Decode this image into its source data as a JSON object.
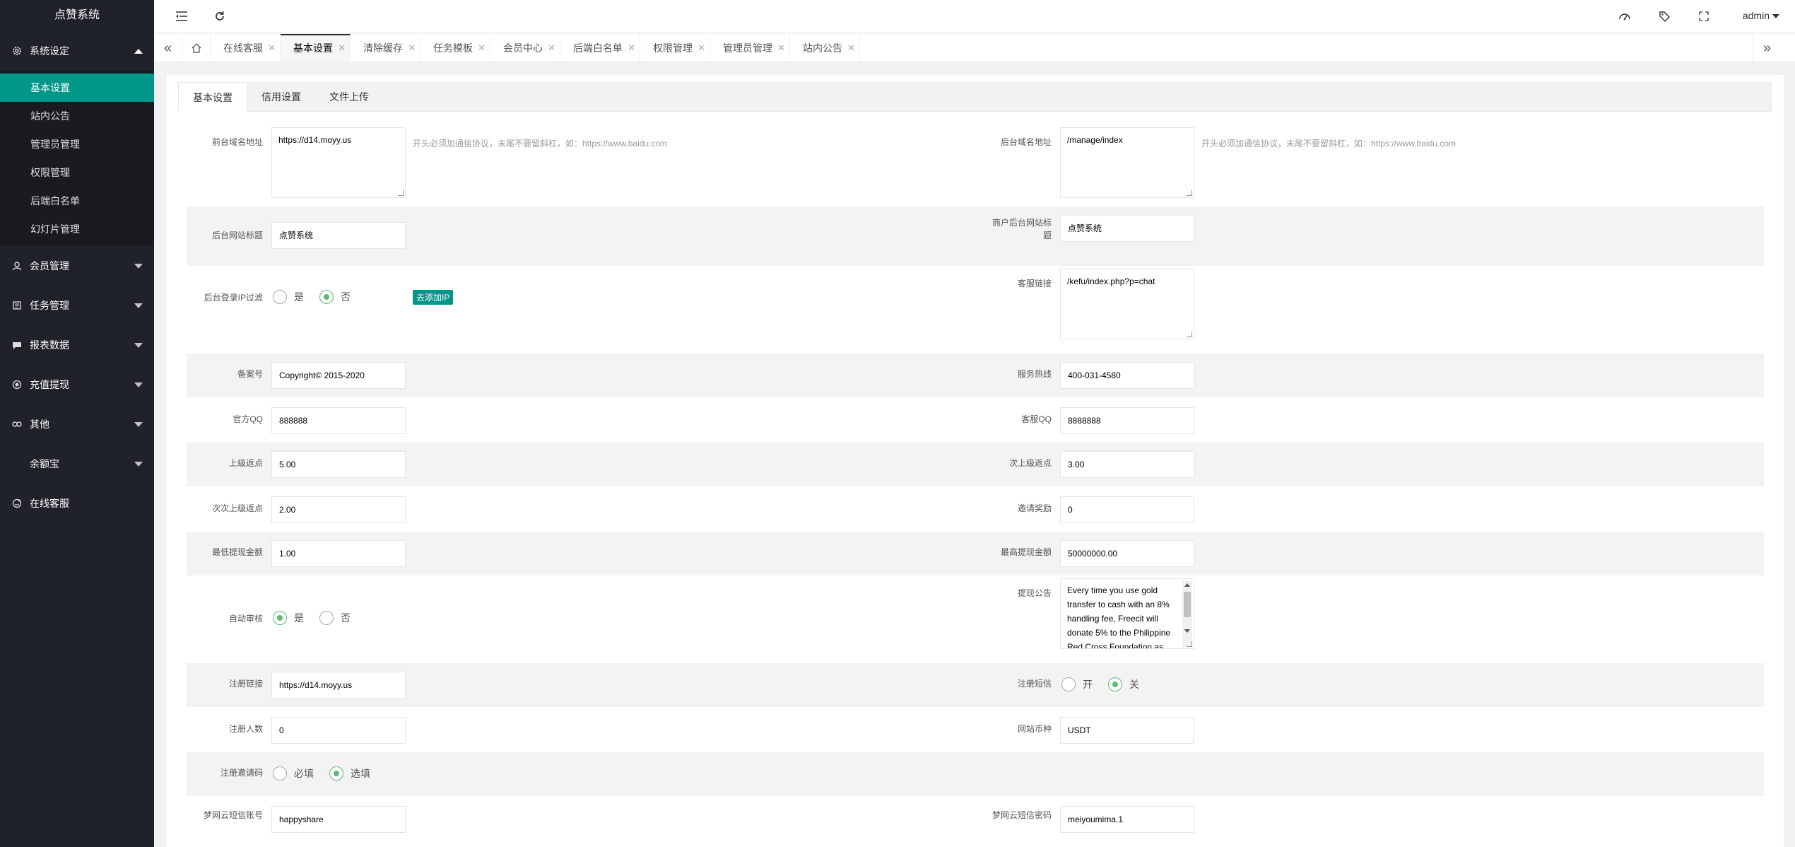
{
  "app": {
    "title": "点赞系统",
    "user": "admin"
  },
  "sidebar": {
    "groups": [
      {
        "label": "系统设定",
        "icon": "gear-icon",
        "expanded": true,
        "items": [
          "基本设置",
          "站内公告",
          "管理员管理",
          "权限管理",
          "后端白名单",
          "幻灯片管理"
        ],
        "active": "基本设置"
      },
      {
        "label": "会员管理",
        "icon": "user-icon"
      },
      {
        "label": "任务管理",
        "icon": "list-icon"
      },
      {
        "label": "报表数据",
        "icon": "chat-icon"
      },
      {
        "label": "充值提现",
        "icon": "coin-icon"
      },
      {
        "label": "其他",
        "icon": "link-icon"
      },
      {
        "label": "余额宝",
        "icon": ""
      },
      {
        "label": "在线客服",
        "icon": "service-icon"
      }
    ]
  },
  "tabs": [
    "在线客服",
    "基本设置",
    "清除缓存",
    "任务模板",
    "会员中心",
    "后端白名单",
    "权限管理",
    "管理员管理",
    "站内公告"
  ],
  "active_tab": "基本设置",
  "content_tabs": [
    "基本设置",
    "信用设置",
    "文件上传"
  ],
  "form": {
    "frontend_domain": {
      "label": "前台域名地址",
      "value": "https://d14.moyy.us",
      "hint": "开头必须加通信协议，末尾不要留斜杠，如：https://www.baidu.com"
    },
    "backend_domain": {
      "label": "后台域名地址",
      "value": "/manage/index",
      "hint": "开头必须加通信协议，末尾不要留斜杠，如：https://www.baidu.com"
    },
    "backend_title": {
      "label": "后台网站标题",
      "value": "点赞系统"
    },
    "merchant_title": {
      "label": "商户后台网站标题",
      "value": "点赞系统"
    },
    "ip_filter": {
      "label": "后台登录IP过滤",
      "options": [
        "是",
        "否"
      ],
      "selected": "否",
      "button": "去添加IP"
    },
    "service_link": {
      "label": "客服链接",
      "value": "/kefu/index.php?p=chat"
    },
    "icp": {
      "label": "备案号",
      "value": "Copyright© 2015-2020"
    },
    "hotline": {
      "label": "服务热线",
      "value": "400-031-4580"
    },
    "official_qq": {
      "label": "官方QQ",
      "value": "888888"
    },
    "service_qq": {
      "label": "客服QQ",
      "value": "8888888"
    },
    "upper_rebate": {
      "label": "上级返点",
      "value": "5.00"
    },
    "second_rebate": {
      "label": "次上级返点",
      "value": "3.00"
    },
    "third_rebate": {
      "label": "次次上级返点",
      "value": "2.00"
    },
    "invite_reward": {
      "label": "邀请奖励",
      "value": "0"
    },
    "min_withdraw": {
      "label": "最低提现金额",
      "value": "1.00"
    },
    "max_withdraw": {
      "label": "最高提现金额",
      "value": "50000000.00"
    },
    "auto_review": {
      "label": "自动审核",
      "options": [
        "是",
        "否"
      ],
      "selected": "是"
    },
    "withdraw_notice": {
      "label": "提现公告",
      "value": "Every time you use gold transfer to cash with an 8% handling fee, Freecit will donate 5% to the Philippine Red Cross Foundation as"
    },
    "register_link": {
      "label": "注册链接",
      "value": "https://d14.moyy.us"
    },
    "register_sms": {
      "label": "注册短信",
      "options": [
        "开",
        "关"
      ],
      "selected": "关"
    },
    "register_count": {
      "label": "注册人数",
      "value": "0"
    },
    "currency": {
      "label": "网站币种",
      "value": "USDT"
    },
    "invite_code": {
      "label": "注册邀请码",
      "options": [
        "必填",
        "选填"
      ],
      "selected": "选填"
    },
    "sms_account": {
      "label": "梦网云短信账号",
      "value": "happyshare"
    },
    "sms_password": {
      "label": "梦网云短信密码",
      "value": "meiyoumima.1"
    }
  }
}
